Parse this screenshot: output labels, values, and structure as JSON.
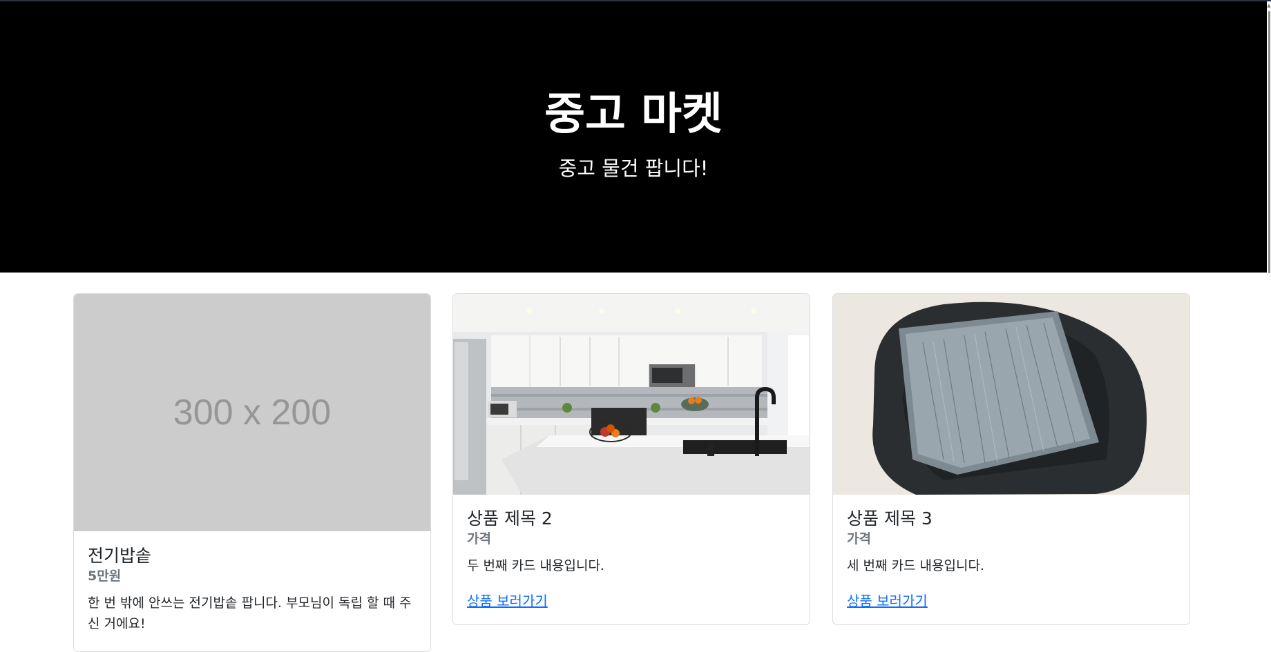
{
  "hero": {
    "title": "중고 마켓",
    "subtitle": "중고 물건 팝니다!"
  },
  "cards": [
    {
      "image_placeholder": "300 x 200",
      "title": "전기밥솥",
      "subtitle": "5만원",
      "text": "한 번 밖에 안쓰는 전기밥솥 팝니다. 부모님이 독립 할 때 주신 거에요!"
    },
    {
      "image": "kitchen-photo",
      "title": "상품 제목 2",
      "subtitle": "가격",
      "text": "두 번째 카드 내용입니다.",
      "link": "상품 보러가기"
    },
    {
      "image": "chair-pillow-photo",
      "title": "상품 제목 3",
      "subtitle": "가격",
      "text": "세 번째 카드 내용입니다.",
      "link": "상품 보러가기"
    }
  ],
  "colors": {
    "hero_bg": "#000000",
    "link": "#0d6efd",
    "muted": "#6c757d",
    "placeholder_bg": "#cccccc"
  }
}
